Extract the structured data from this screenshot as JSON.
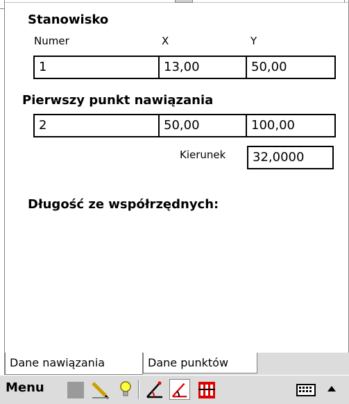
{
  "stanowisko": {
    "heading": "Stanowisko",
    "col_numer": "Numer",
    "col_x": "X",
    "col_y": "Y",
    "numer": "1",
    "x": "13,00",
    "y": "50,00"
  },
  "pierwszy_punkt": {
    "heading": "Pierwszy punkt nawiązania",
    "numer": "2",
    "x": "50,00",
    "y": "100,00",
    "kierunek_label": "Kierunek",
    "kierunek": "32,0000"
  },
  "dlugosc": {
    "heading": "Długość ze współrzędnych:"
  },
  "tabs": [
    {
      "label": "Dane nawiązania",
      "active": true
    },
    {
      "label": "Dane punktów",
      "active": false
    }
  ],
  "toolbar": {
    "menu_label": "Menu",
    "icons": [
      "gray-square-icon",
      "pencil-icon",
      "lightbulb-icon",
      "angle-icon",
      "angle-active-icon",
      "calculator-icon",
      "keyboard-icon",
      "arrow-up-icon"
    ]
  },
  "colors": {
    "accent_red": "#e00000",
    "toolbar_bg": "#dcdcdc"
  }
}
